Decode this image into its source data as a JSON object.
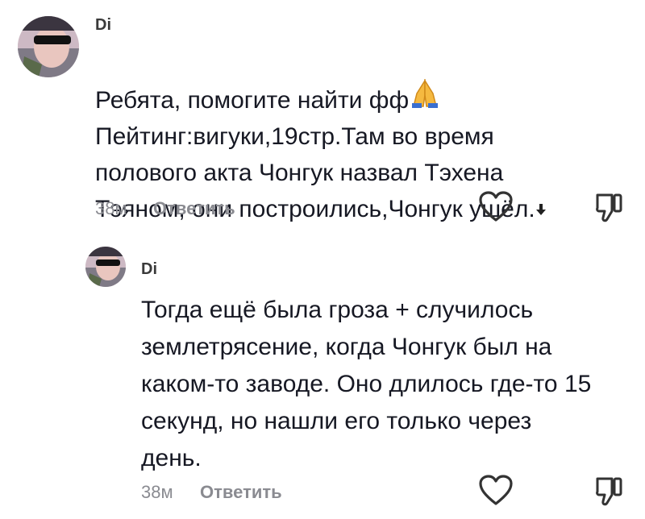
{
  "comments": [
    {
      "username": "Di",
      "text_line1": "Ребята, помогите найти фф",
      "text_rest": "Пейтинг:вигуки,19стр.Там во время\nполового акта Чонгук назвал Тэхена\nТэяном, они построились,Чонгук ушёл.",
      "emoji_icon": "pray-icon",
      "expand_icon": "arrow-down-icon",
      "time": "38м",
      "reply_label": "Ответить"
    },
    {
      "username": "Di",
      "text": "Тогда ещё была гроза + случилось\nземлетрясение, когда Чонгук был на\nкаком-то заводе. Оно длилось где-то 15\nсекунд, но нашли его только через\nдень.",
      "time": "38м",
      "reply_label": "Ответить"
    }
  ],
  "icons": {
    "like": "heart-outline-icon",
    "dislike": "thumbs-down-outline-icon"
  }
}
